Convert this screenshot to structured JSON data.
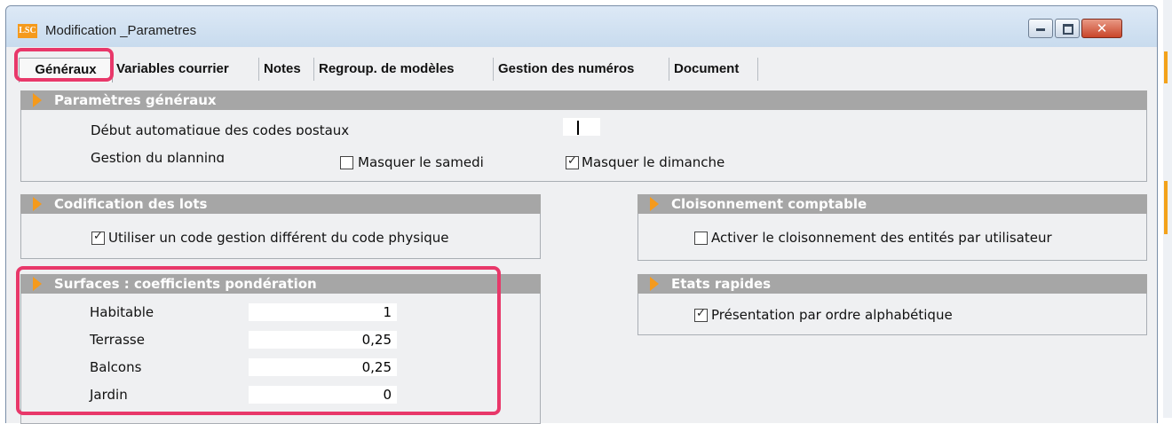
{
  "window": {
    "app_icon_text": "LSC",
    "title": "Modification _Parametres",
    "controls": [
      "minimize",
      "maximize",
      "close"
    ],
    "close_glyph": "✕"
  },
  "tabs": [
    {
      "label": "Généraux",
      "active": true
    },
    {
      "label": "Variables courrier",
      "active": false
    },
    {
      "label": "Notes",
      "active": false
    },
    {
      "label": "Regroup. de modèles",
      "active": false
    },
    {
      "label": "Gestion des numéros",
      "active": false
    },
    {
      "label": "Document",
      "active": false
    }
  ],
  "groups": {
    "parametres": {
      "title": "Paramètres généraux",
      "row1_label": "Début automatique des codes postaux",
      "row1_value": "",
      "row2_label": "Gestion du planning",
      "masquer_samedi": {
        "label": "Masquer le samedi",
        "checked": false
      },
      "masquer_dimanche": {
        "label": "Masquer le dimanche",
        "checked": true
      }
    },
    "lots": {
      "title": "Codification des lots",
      "option": {
        "label": "Utiliser un code gestion différent du code physique",
        "checked": true
      }
    },
    "cloisonnement": {
      "title": "Cloisonnement comptable",
      "option": {
        "label": "Activer le cloisonnement des entités par utilisateur",
        "checked": false
      }
    },
    "surfaces": {
      "title": "Surfaces  : coefficients pondération",
      "rows": [
        {
          "label": "Habitable",
          "value": "1"
        },
        {
          "label": "Terrasse",
          "value": "0,25"
        },
        {
          "label": "Balcons",
          "value": "0,25"
        },
        {
          "label": "Jardin",
          "value": "0"
        }
      ]
    },
    "etats": {
      "title": "Etats rapides",
      "option": {
        "label": "Présentation par ordre alphabétique",
        "checked": true
      }
    }
  },
  "colors": {
    "highlight": "#e8386a",
    "group_header": "#a6a6a6",
    "arrow": "#f59a1c",
    "window_bg": "#eff0f2"
  },
  "check_glyph": "✓"
}
